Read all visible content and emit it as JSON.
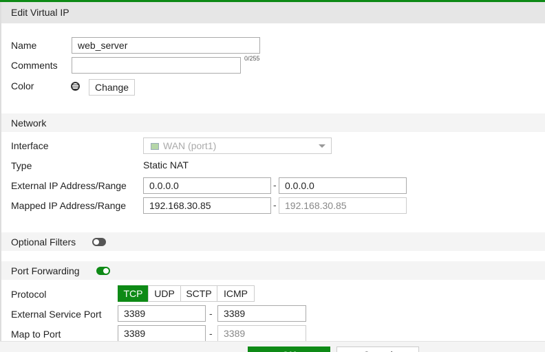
{
  "dialog": {
    "title": "Edit Virtual IP"
  },
  "general": {
    "name_label": "Name",
    "name_value": "web_server",
    "comments_label": "Comments",
    "comments_value": "",
    "comments_counter": "0/255",
    "color_label": "Color",
    "change_button": "Change"
  },
  "network": {
    "section_title": "Network",
    "interface_label": "Interface",
    "interface_value": "WAN (port1)",
    "type_label": "Type",
    "type_value": "Static NAT",
    "external_ip_label": "External IP Address/Range",
    "external_ip_start": "0.0.0.0",
    "external_ip_end": "0.0.0.0",
    "mapped_ip_label": "Mapped IP Address/Range",
    "mapped_ip_start": "192.168.30.85",
    "mapped_ip_end": "192.168.30.85",
    "dash": "-"
  },
  "optional_filters": {
    "label": "Optional Filters",
    "enabled": false
  },
  "port_forwarding": {
    "label": "Port Forwarding",
    "enabled": true,
    "protocol_label": "Protocol",
    "protocols": [
      "TCP",
      "UDP",
      "SCTP",
      "ICMP"
    ],
    "selected_protocol": "TCP",
    "external_port_label": "External Service Port",
    "external_port_start": "3389",
    "external_port_end": "3389",
    "map_port_label": "Map to Port",
    "map_port_start": "3389",
    "map_port_end": "3389",
    "dash": "-"
  },
  "footer": {
    "ok_button": "OK",
    "cancel_button": "Cancel"
  },
  "colors": {
    "accent": "#0e8a16"
  }
}
